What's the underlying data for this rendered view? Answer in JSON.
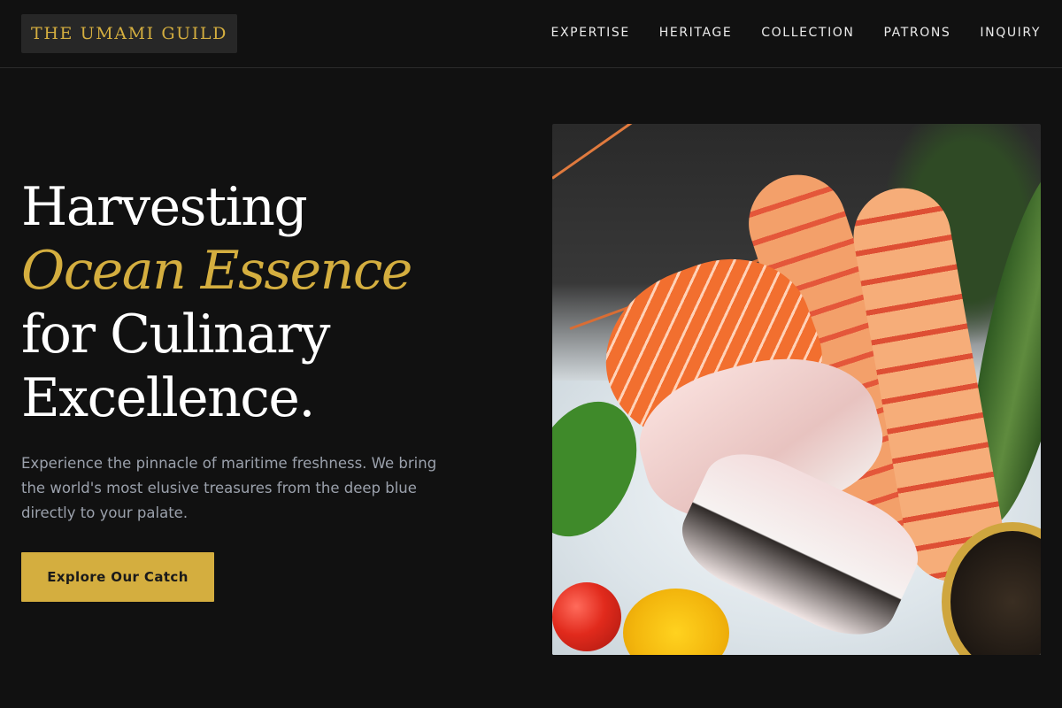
{
  "brand": {
    "name": "THE UMAMI GUILD",
    "accent_color": "#d4ae3f",
    "background_color": "#111111"
  },
  "nav": {
    "items": [
      {
        "label": "EXPERTISE"
      },
      {
        "label": "HERITAGE"
      },
      {
        "label": "COLLECTION"
      },
      {
        "label": "PATRONS"
      },
      {
        "label": "INQUIRY"
      }
    ]
  },
  "hero": {
    "title_line_1": "Harvesting",
    "title_accent": "Ocean Essence",
    "title_line_3": "for Culinary",
    "title_line_4": "Excellence.",
    "intro": "Experience the pinnacle of maritime freshness. We bring the world's most elusive treasures from the deep blue directly to your palate.",
    "cta_label": "Explore Our Catch"
  }
}
